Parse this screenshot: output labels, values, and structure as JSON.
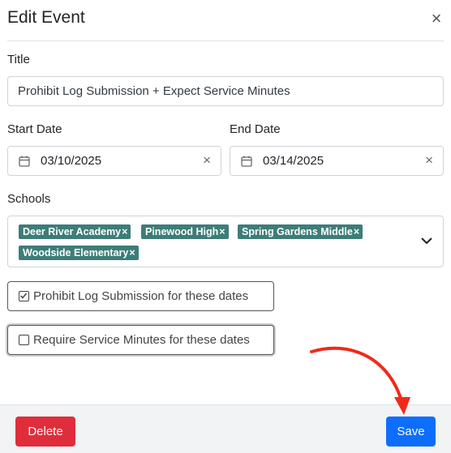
{
  "modal": {
    "title": "Edit Event",
    "close_icon": "close-icon"
  },
  "form": {
    "title_label": "Title",
    "title_value": "Prohibit Log Submission + Expect Service Minutes",
    "start_date_label": "Start Date",
    "start_date_value": "03/10/2025",
    "end_date_label": "End Date",
    "end_date_value": "03/14/2025",
    "schools_label": "Schools",
    "schools": [
      {
        "label": "Deer River Academy"
      },
      {
        "label": "Pinewood High"
      },
      {
        "label": "Spring Gardens Middle"
      },
      {
        "label": "Woodside Elementary"
      }
    ],
    "chip_remove_glyph": "×",
    "prohibit_label": "Prohibit Log Submission for these dates",
    "prohibit_checked": true,
    "require_label": "Require Service Minutes for these dates",
    "require_checked": false
  },
  "footer": {
    "delete_label": "Delete",
    "save_label": "Save"
  },
  "colors": {
    "chip": "#3d7d78",
    "delete": "#e02d3c",
    "save": "#0d6efd",
    "annotation_arrow": "#f02a1a"
  }
}
